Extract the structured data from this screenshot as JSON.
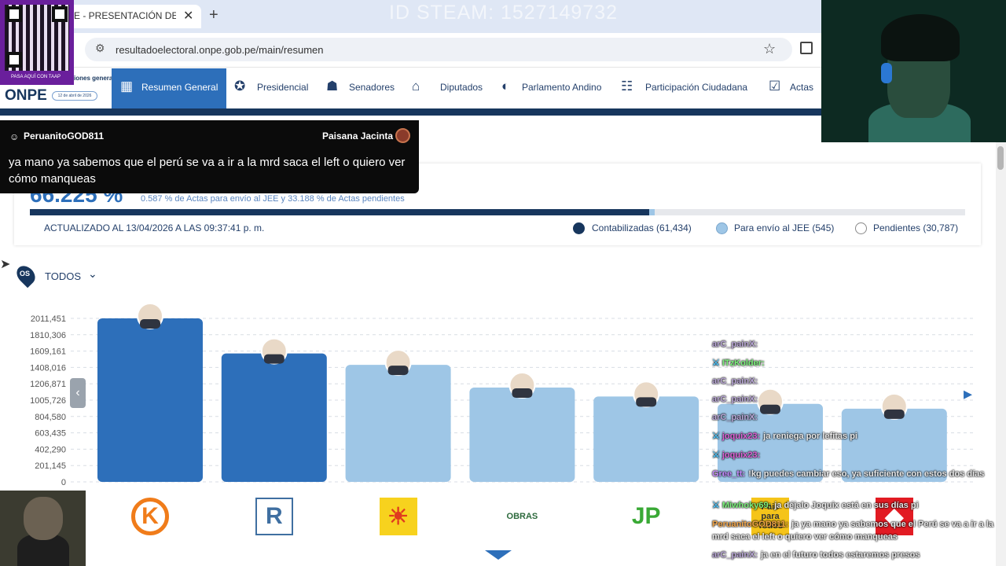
{
  "browser": {
    "tab_title": "E - PRESENTACIÓN DE RE",
    "tab_close": "✕",
    "new_tab": "+",
    "url": "resultadoelectoral.onpe.gob.pe/main/resumen",
    "overlay_watermark": "ID STEAM: 1527149732"
  },
  "site": {
    "logo": "ONPE",
    "elecciones": "iones\ngenerales",
    "fecha": "12 de abril de 2026",
    "qr_caption": "PASA AQUÍ CON TAAP"
  },
  "nav": {
    "active": "Resumen General",
    "items": [
      "Presidencial",
      "Senadores",
      "Diputados",
      "Parlamento Andino",
      "Participación Ciudadana",
      "Actas"
    ]
  },
  "chat_popup": {
    "user": "PeruanitoGOD811",
    "channel": "Paisana Jacinta",
    "message": "ya mano ya sabemos que el perú se va a ir a la mrd saca el left o quiero ver cómo manqueas"
  },
  "summary": {
    "percent": "66.225 %",
    "subtitle": "0.587 % de Actas para envío al JEE y 33.188 % de Actas pendientes",
    "updated": "ACTUALIZADO AL 13/04/2026 A LAS 09:37:41 p. m.",
    "progress_contabilizadas": 66.225,
    "progress_jee": 0.587,
    "legend": [
      {
        "label": "Contabilizadas (61,434)",
        "color": "#17365d"
      },
      {
        "label": "Para envío al JEE (545)",
        "color": "#9ec6e6"
      },
      {
        "label": "Pendientes (30,787)",
        "color": "#ffffff"
      }
    ]
  },
  "filter": {
    "label": "TODOS",
    "pin_text": "OS"
  },
  "chart_data": {
    "type": "bar",
    "yticks": [
      "2011,451",
      "1810,306",
      "1609,161",
      "1408,016",
      "1206,871",
      "1005,726",
      "804,580",
      "603,435",
      "402,290",
      "201,145",
      "0"
    ],
    "ylim": [
      0,
      2011451
    ],
    "values": [
      2011451,
      1580000,
      1440000,
      1160000,
      1050000,
      960000,
      900000
    ],
    "colors": [
      "#2d6fba",
      "#2d6fba",
      "#9ec6e6",
      "#9ec6e6",
      "#9ec6e6",
      "#9ec6e6",
      "#9ec6e6"
    ],
    "party_logos": [
      {
        "name": "k-logo-icon",
        "text": "K",
        "bg": "#ffffff",
        "fg": "#f07c1a"
      },
      {
        "name": "r-logo-icon",
        "text": "R",
        "bg": "#ffffff",
        "fg": "#3f6fa1"
      },
      {
        "name": "sun-logo-icon",
        "text": "☀",
        "bg": "#f7d21e",
        "fg": "#e03a1e"
      },
      {
        "name": "obras-logo-icon",
        "text": "OBRAS",
        "bg": "#ffffff",
        "fg": "#2d6a3d"
      },
      {
        "name": "jp-logo-icon",
        "text": "JP",
        "bg": "#ffffff",
        "fg": "#39a935"
      },
      {
        "name": "pais-logo-icon",
        "text": "Pais para Todos",
        "bg": "#f5c41a",
        "fg": "#333333"
      },
      {
        "name": "red-logo-icon",
        "text": "◆",
        "bg": "#e21b23",
        "fg": "#ffffff"
      }
    ]
  },
  "stream_chat": [
    {
      "user": "arC_painX:",
      "text": "",
      "color": "#b9a6d6",
      "mod": false
    },
    {
      "user": "ITzKolder:",
      "text": "",
      "color": "#7cf27c",
      "mod": true
    },
    {
      "user": "arC_painX:",
      "text": "",
      "color": "#b9a6d6",
      "mod": false
    },
    {
      "user": "arC_painX:",
      "text": "",
      "color": "#b9a6d6",
      "mod": false
    },
    {
      "user": "arC_painX:",
      "text": "",
      "color": "#b9a6d6",
      "mod": false
    },
    {
      "user": "joquix23:",
      "text": "ja reniega por lefitas pi",
      "color": "#e05fd6",
      "mod": true
    },
    {
      "user": "joquix23:",
      "text": "",
      "color": "#e05fd6",
      "mod": true
    },
    {
      "user": "Gree_tt:",
      "text": "!kg puedes cambiar eso, ya suficiente con estos dos días",
      "color": "#c58cff",
      "mod": false
    },
    {
      "user": "Miwhoky69:",
      "text": "ja déjalo Joquix está en sus días pi",
      "color": "#7cf27c",
      "mod": true
    },
    {
      "user": "PeruanitoGOD811:",
      "text": "ja ya mano ya sabemos que el Perú se va a ir a la mrd saca el left o quiero ver cómo manqueas",
      "color": "#f2a64a",
      "mod": false
    },
    {
      "user": "arC_painX:",
      "text": "ja en el futuro todos estaremos presos",
      "color": "#b9a6d6",
      "mod": false
    }
  ]
}
